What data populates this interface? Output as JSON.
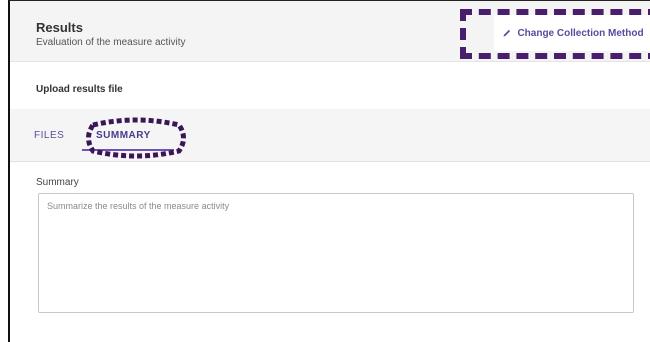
{
  "header": {
    "title": "Results",
    "subtitle": "Evaluation of the measure activity",
    "change_button_label": "Change Collection Method",
    "change_button_icon": "pencil-icon"
  },
  "upload": {
    "label": "Upload results file"
  },
  "tabs": [
    {
      "label": "FILES",
      "selected": false
    },
    {
      "label": "SUMMARY",
      "selected": true
    }
  ],
  "summary": {
    "label": "Summary",
    "value": "",
    "placeholder": "Summarize the results of the measure activity"
  },
  "colors": {
    "accent": "#5c4a9e",
    "highlight_outline": "#4a1e6e",
    "header_bg": "#f4f4f4"
  }
}
